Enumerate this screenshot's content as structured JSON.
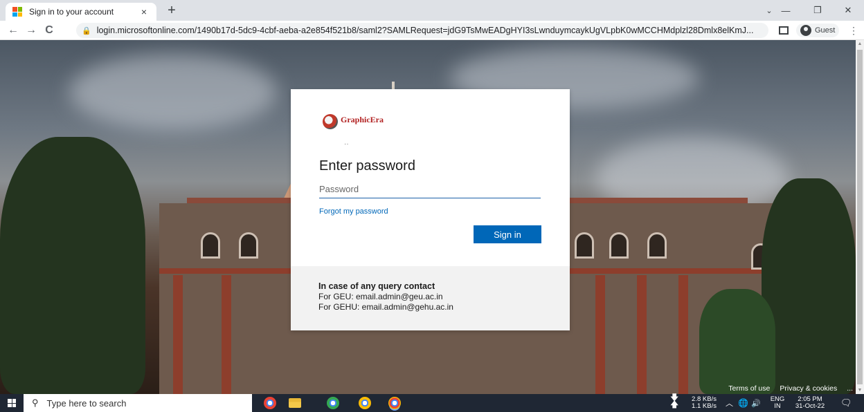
{
  "browser": {
    "tab_title": "Sign in to your account",
    "tab_close": "×",
    "new_tab": "+",
    "address": "login.microsoftonline.com/1490b17d-5dc9-4cbf-aeba-a2e854f521b8/saml2?SAMLRequest=jdG9TsMwEADgHYI3sLwnduymcaykUgVLpbK0wMCCHMdplzl28Dmlx8elKmJ...",
    "profile_label": "Guest",
    "minimize": "—",
    "maximize": "❐",
    "close": "✕",
    "back": "←",
    "forward": "→",
    "reload": "C",
    "menu": "⋮"
  },
  "signin": {
    "logo_text": "GraphicEra",
    "dots": "··",
    "heading": "Enter password",
    "password_placeholder": "Password",
    "forgot_link": "Forgot my password",
    "signin_button": "Sign in",
    "footer_title": "In case of any query contact",
    "footer_line_1": "For GEU: email.admin@geu.ac.in",
    "footer_line_2": "For GEHU: email.admin@gehu.ac.in"
  },
  "page_footer": {
    "terms": "Terms of use",
    "privacy": "Privacy & cookies",
    "more": "..."
  },
  "taskbar": {
    "search_placeholder": "Type here to search",
    "net_up": "2.8 KB/s",
    "net_down": "1.1 KB/s",
    "lang_1": "ENG",
    "lang_2": "IN",
    "time": "2:05 PM",
    "date": "31-Oct-22"
  },
  "colors": {
    "accent": "#0067b8",
    "taskbar": "#1f2734"
  }
}
